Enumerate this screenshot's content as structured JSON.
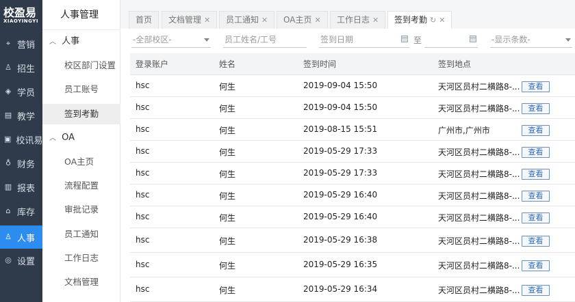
{
  "app": {
    "logo_cn": "校盈易",
    "logo_en": "XIAOYINGYI"
  },
  "nav": {
    "items": [
      {
        "label": "营销",
        "icon": "tag-icon"
      },
      {
        "label": "招生",
        "icon": "user-icon"
      },
      {
        "label": "学员",
        "icon": "graduation-cap-icon"
      },
      {
        "label": "教学",
        "icon": "book-icon"
      },
      {
        "label": "校讯易",
        "icon": "message-icon"
      },
      {
        "label": "财务",
        "icon": "money-bag-icon"
      },
      {
        "label": "报表",
        "icon": "report-icon"
      },
      {
        "label": "库存",
        "icon": "warehouse-icon"
      },
      {
        "label": "人事",
        "icon": "people-icon",
        "active": true
      },
      {
        "label": "设置",
        "icon": "gear-icon"
      }
    ]
  },
  "submenu": {
    "title": "人事管理",
    "group1": "人事",
    "group1_items": [
      "校区部门设置",
      "员工账号",
      "签到考勤"
    ],
    "group2": "OA",
    "group2_items": [
      "OA主页",
      "流程配置",
      "审批记录",
      "员工通知",
      "工作日志",
      "文档管理"
    ]
  },
  "tabs": [
    {
      "label": "首页",
      "closable": false
    },
    {
      "label": "文档管理",
      "closable": true
    },
    {
      "label": "员工通知",
      "closable": true
    },
    {
      "label": "OA主页",
      "closable": true
    },
    {
      "label": "工作日志",
      "closable": true
    },
    {
      "label": "签到考勤",
      "closable": true,
      "active": true
    }
  ],
  "filters": {
    "campus": "-全部校区-",
    "employee": "员工姓名/工号",
    "date_label": "签到日期",
    "to_label": "至",
    "page_size": "-显示条数-"
  },
  "table": {
    "headers": [
      "登录账户",
      "姓名",
      "签到时间",
      "签到地点"
    ],
    "view_label": "查看",
    "rows": [
      {
        "account": "hsc",
        "name": "何生",
        "time": "2019-09-04 15:50",
        "location": "天河区员村二横路8-..."
      },
      {
        "account": "hsc",
        "name": "何生",
        "time": "2019-09-04 15:50",
        "location": "天河区员村二横路8-..."
      },
      {
        "account": "hsc",
        "name": "何生",
        "time": "2019-08-15 15:51",
        "location": "广州市,广州市"
      },
      {
        "account": "hsc",
        "name": "何生",
        "time": "2019-05-29 17:33",
        "location": "天河区员村二横路8-..."
      },
      {
        "account": "hsc",
        "name": "何生",
        "time": "2019-05-29 17:33",
        "location": "天河区员村二横路8-..."
      },
      {
        "account": "hsc",
        "name": "何生",
        "time": "2019-05-29 16:40",
        "location": "天河区员村二横路8-..."
      },
      {
        "account": "hsc",
        "name": "何生",
        "time": "2019-05-29 16:40",
        "location": "天河区员村二横路8-..."
      },
      {
        "account": "hsc",
        "name": "何生",
        "time": "2019-05-29 16:38",
        "location": "天河区员村二横路8-..."
      },
      {
        "account": "hsc",
        "name": "何生",
        "time": "2019-05-29 16:35",
        "location": "天河区员村二横路8-..."
      },
      {
        "account": "hsc",
        "name": "何生",
        "time": "2019-05-29 16:34",
        "location": "天河区员村二横路8-..."
      }
    ]
  },
  "colors": {
    "nav_bg": "#2f3a4a",
    "accent": "#2d8cf0"
  }
}
